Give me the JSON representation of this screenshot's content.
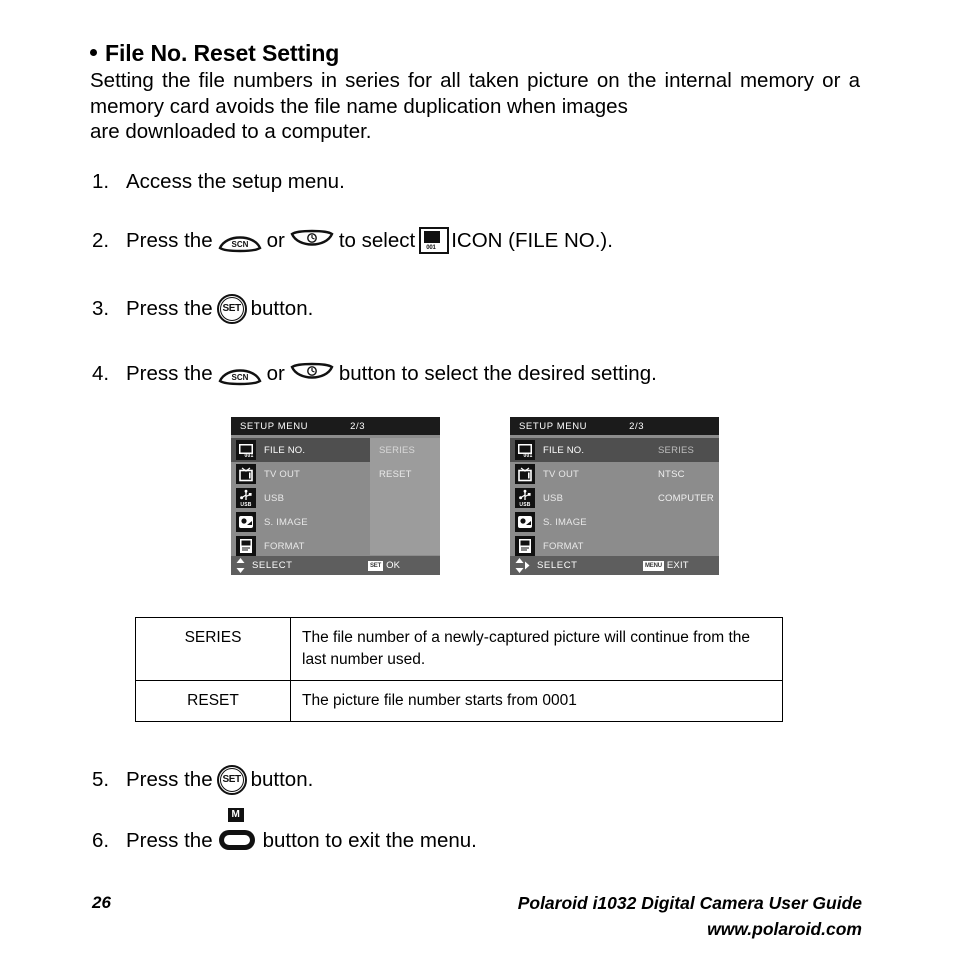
{
  "section": {
    "title": "File No. Reset Setting",
    "intro_line1": "Setting the file numbers in series for all taken picture on the internal",
    "intro_line2": "memory or a memory card avoids the file name duplication when images",
    "intro_line3": "are downloaded to a computer."
  },
  "steps": {
    "s1": {
      "num": "1.",
      "text": "Access the setup menu."
    },
    "s2": {
      "num": "2.",
      "pre": "Press the",
      "mid": "or",
      "post": "to select",
      "tail": "ICON (FILE NO.)."
    },
    "s3": {
      "num": "3.",
      "pre": "Press the",
      "post": "button."
    },
    "s4": {
      "num": "4.",
      "pre": "Press the",
      "mid": "or",
      "post": "button to select the desired setting."
    },
    "s5": {
      "num": "5.",
      "pre": "Press the",
      "post": "button."
    },
    "s6": {
      "num": "6.",
      "pre": "Press the",
      "post": "button to exit the menu."
    }
  },
  "icons": {
    "scn_label": "SCN",
    "timer_label": "timer-icon",
    "set_label": "SET",
    "menu_button_label": "M",
    "fileno_number": "001"
  },
  "menu_left": {
    "title": "SETUP MENU",
    "page": "2/3",
    "rows": [
      {
        "label": "FILE NO.",
        "icon": "file-no-icon",
        "value": "SERIES",
        "highlight": true
      },
      {
        "label": "TV OUT",
        "icon": "tv-out-icon",
        "value": "RESET",
        "highlight": false
      },
      {
        "label": "USB",
        "icon": "usb-icon",
        "value": "",
        "highlight": false
      },
      {
        "label": "S. IMAGE",
        "icon": "s-image-icon",
        "value": "",
        "highlight": false
      },
      {
        "label": "FORMAT",
        "icon": "format-icon",
        "value": "",
        "highlight": false
      }
    ],
    "footer_select": "SELECT",
    "footer_badge": "SET",
    "footer_action": "OK"
  },
  "menu_right": {
    "title": "SETUP MENU",
    "page": "2/3",
    "rows": [
      {
        "label": "FILE NO.",
        "icon": "file-no-icon",
        "value": "SERIES",
        "highlight": true
      },
      {
        "label": "TV OUT",
        "icon": "tv-out-icon",
        "value": "NTSC",
        "highlight": false
      },
      {
        "label": "USB",
        "icon": "usb-icon",
        "value": "COMPUTER",
        "highlight": false
      },
      {
        "label": "S. IMAGE",
        "icon": "s-image-icon",
        "value": "",
        "highlight": false
      },
      {
        "label": "FORMAT",
        "icon": "format-icon",
        "value": "",
        "highlight": false
      }
    ],
    "footer_select": "SELECT",
    "footer_badge": "MENU",
    "footer_action": "EXIT"
  },
  "table": {
    "rows": [
      {
        "key": "SERIES",
        "desc": "The file number of a newly-captured picture will continue from the last number used."
      },
      {
        "key": "RESET",
        "desc": "The picture file number starts from 0001"
      }
    ]
  },
  "footer": {
    "page_number": "26",
    "guide": "Polaroid i1032 Digital Camera User Guide",
    "website": "www.polaroid.com"
  },
  "colors": {
    "menu_bg": "#8c8c8c",
    "menu_title_bar": "#1b1b1b",
    "menu_highlight": "#4f4f4f",
    "menu_values_panel": "#9c9c9c",
    "menu_footer": "#5e5e5e",
    "text": "#000000"
  }
}
